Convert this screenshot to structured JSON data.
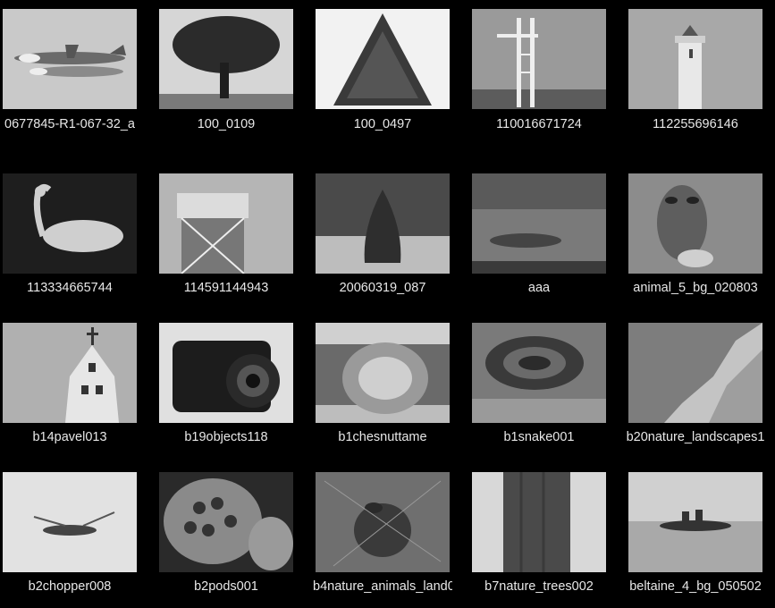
{
  "gallery": {
    "items": [
      {
        "name": "0677845-R1-067-32_a",
        "thumb": "airplanes-icon"
      },
      {
        "name": "100_0109",
        "thumb": "tree-icon"
      },
      {
        "name": "100_0497",
        "thumb": "pine-tree-icon"
      },
      {
        "name": "110016671724",
        "thumb": "tower-icon"
      },
      {
        "name": "112255696146",
        "thumb": "lighthouse-icon"
      },
      {
        "name": "113334665744",
        "thumb": "swan-icon"
      },
      {
        "name": "114591144943",
        "thumb": "water-tower-icon"
      },
      {
        "name": "20060319_087",
        "thumb": "stone-cairn-icon"
      },
      {
        "name": "aaa",
        "thumb": "cloudy-sky-icon"
      },
      {
        "name": "animal_5_bg_020803",
        "thumb": "owl-icon"
      },
      {
        "name": "b14pavel013",
        "thumb": "bell-tower-icon"
      },
      {
        "name": "b19objects118",
        "thumb": "camera-icon"
      },
      {
        "name": "b1chesnuttame",
        "thumb": "chestnut-burr-icon"
      },
      {
        "name": "b1snake001",
        "thumb": "snake-icon"
      },
      {
        "name": "b20nature_landscapes1",
        "thumb": "cliff-icon"
      },
      {
        "name": "b2chopper008",
        "thumb": "helicopter-icon"
      },
      {
        "name": "b2pods001",
        "thumb": "lotus-pod-icon"
      },
      {
        "name": "b4nature_animals_land0",
        "thumb": "frog-icon"
      },
      {
        "name": "b7nature_trees002",
        "thumb": "tree-trunk-icon"
      },
      {
        "name": "beltaine_4_bg_050502",
        "thumb": "island-icon"
      }
    ]
  }
}
